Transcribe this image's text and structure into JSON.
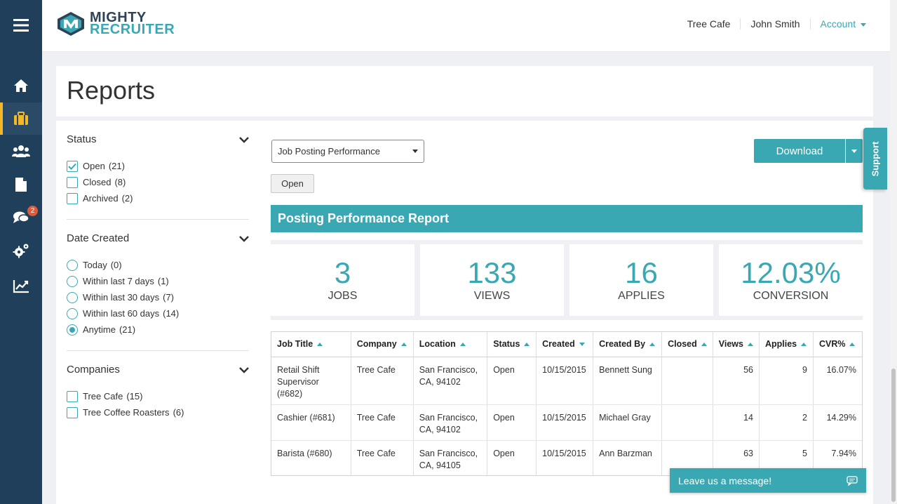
{
  "app": {
    "logo_line1": "MIGHTY",
    "logo_line2": "RECRUITER",
    "accent": "#3aa8b3",
    "sidebar_bg": "#1f3f5a"
  },
  "sidebar": {
    "items": [
      {
        "icon": "menu-icon"
      },
      {
        "icon": "home-icon"
      },
      {
        "icon": "briefcase-icon",
        "active": true
      },
      {
        "icon": "users-icon"
      },
      {
        "icon": "document-icon"
      },
      {
        "icon": "chat-icon",
        "badge": "2"
      },
      {
        "icon": "gears-icon"
      },
      {
        "icon": "chart-icon"
      }
    ]
  },
  "header": {
    "company": "Tree Cafe",
    "user": "John Smith",
    "account": "Account"
  },
  "page": {
    "title": "Reports"
  },
  "filters": {
    "status": {
      "label": "Status",
      "options": [
        {
          "label": "Open",
          "count": "(21)",
          "checked": true
        },
        {
          "label": "Closed",
          "count": "(8)",
          "checked": false
        },
        {
          "label": "Archived",
          "count": "(2)",
          "checked": false
        }
      ]
    },
    "date": {
      "label": "Date Created",
      "options": [
        {
          "label": "Today",
          "count": "(0)",
          "checked": false
        },
        {
          "label": "Within last 7 days",
          "count": "(1)",
          "checked": false
        },
        {
          "label": "Within last 30 days",
          "count": "(7)",
          "checked": false
        },
        {
          "label": "Within last 60 days",
          "count": "(14)",
          "checked": false
        },
        {
          "label": "Anytime",
          "count": "(21)",
          "checked": true
        }
      ]
    },
    "companies": {
      "label": "Companies",
      "options": [
        {
          "label": "Tree Cafe",
          "count": "(15)",
          "checked": false
        },
        {
          "label": "Tree Coffee Roasters",
          "count": "(6)",
          "checked": false
        }
      ]
    }
  },
  "report": {
    "select_value": "Job Posting Performance",
    "open_label": "Open",
    "download_label": "Download",
    "banner": "Posting Performance Report",
    "stats": [
      {
        "value": "3",
        "label": "JOBS"
      },
      {
        "value": "133",
        "label": "VIEWS"
      },
      {
        "value": "16",
        "label": "APPLIES"
      },
      {
        "value": "12.03%",
        "label": "CONVERSION"
      }
    ],
    "columns": [
      "Job Title",
      "Company",
      "Location",
      "Status",
      "Created",
      "Created By",
      "Closed",
      "Views",
      "Applies",
      "CVR%"
    ],
    "rows": [
      [
        "Retail Shift Supervisor (#682)",
        "Tree Cafe",
        "San Francisco, CA, 94102",
        "Open",
        "10/15/2015",
        "Bennett Sung",
        "",
        "56",
        "9",
        "16.07%"
      ],
      [
        "Cashier (#681)",
        "Tree Cafe",
        "San Francisco, CA, 94102",
        "Open",
        "10/15/2015",
        "Michael Gray",
        "",
        "14",
        "2",
        "14.29%"
      ],
      [
        "Barista (#680)",
        "Tree Cafe",
        "San Francisco, CA, 94105",
        "Open",
        "10/15/2015",
        "Ann Barzman",
        "",
        "63",
        "5",
        "7.94%"
      ]
    ]
  },
  "support_label": "Support",
  "chat_label": "Leave us a message!"
}
